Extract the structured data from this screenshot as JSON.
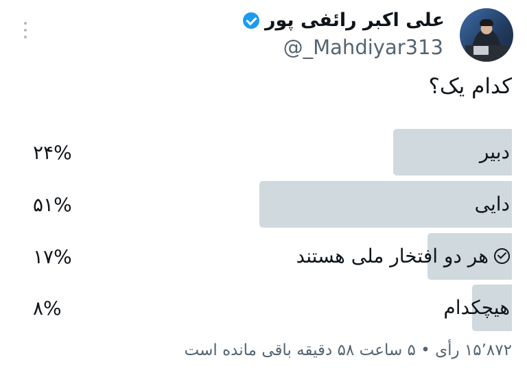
{
  "tweet": {
    "author": {
      "name": "علی اکبر رائفی پور",
      "handle": "@_Mahdiyar313",
      "verified": true
    },
    "question": "کدام یک؟",
    "poll": {
      "options": [
        {
          "label": "دبیر",
          "percent_text": "۲۴%",
          "share": 24,
          "selected": false
        },
        {
          "label": "دایی",
          "percent_text": "۵۱%",
          "share": 51,
          "selected": false
        },
        {
          "label": "هر دو افتخار ملی هستند",
          "percent_text": "۱۷%",
          "share": 17,
          "selected": true
        },
        {
          "label": "هیچکدام",
          "percent_text": "۸%",
          "share": 8,
          "selected": false
        }
      ],
      "footer": "۱۵٬۸۷۲ رأی • ۵ ساعت ۵۸ دقیقه باقی مانده است"
    }
  },
  "icons": {
    "more": "more-vertical-icon",
    "verified": "verified-badge-icon",
    "selected": "check-circle-icon"
  },
  "colors": {
    "bar": "#cfd9de",
    "verified": "#1d9bf0",
    "secondary_text": "#536471"
  }
}
